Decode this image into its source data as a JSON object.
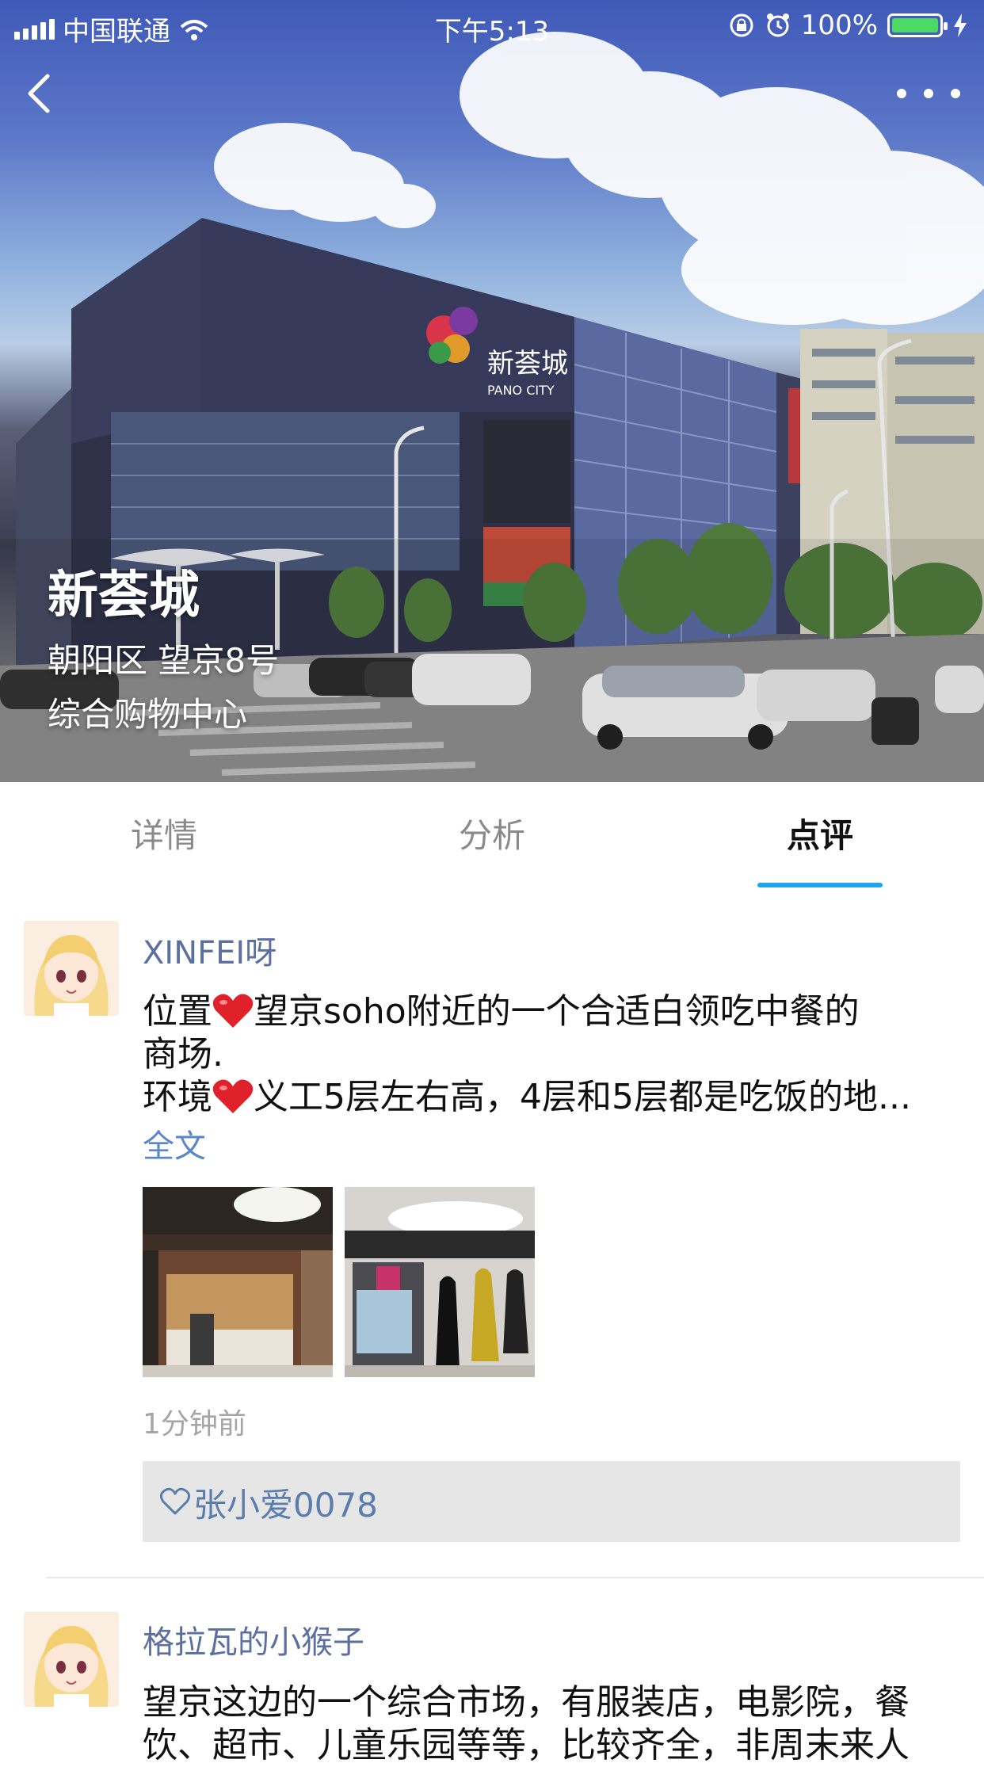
{
  "status_bar": {
    "carrier": "中国联通",
    "time": "下午5:13",
    "battery": "100%",
    "battery_level": 1.0
  },
  "header": {
    "back_icon": "chevron-left-icon",
    "more_icon": "ellipsis-icon"
  },
  "place": {
    "name": "新荟城",
    "address": "朝阳区 望京8号",
    "category": "综合购物中心",
    "sign_cn": "新荟城",
    "sign_en": "PANO CITY"
  },
  "tabs": [
    {
      "label": "详情",
      "active": false
    },
    {
      "label": "分析",
      "active": false
    },
    {
      "label": "点评",
      "active": true
    }
  ],
  "reviews": [
    {
      "author": "XINFEI呀",
      "line1_a": "位置",
      "line1_b": "望京soho附近的一个合适白领吃中餐的",
      "line2": "商场.",
      "line3_a": "环境",
      "line3_b": "义工5层左右高，4层和5层都是吃饭的地...",
      "more": "全文",
      "time": "1分钟前",
      "liked_by": "张小爱0078"
    },
    {
      "author": "格拉瓦的小猴子",
      "line1": "望京这边的一个综合市场，有服装店，电影院，餐",
      "line2": "饮、超市、儿童乐园等等，比较齐全，非周末来人"
    }
  ],
  "colors": {
    "accent": "#1aa7ec",
    "link": "#5b86c8",
    "author": "#5b6fa0",
    "battery_green": "#4cd964"
  }
}
